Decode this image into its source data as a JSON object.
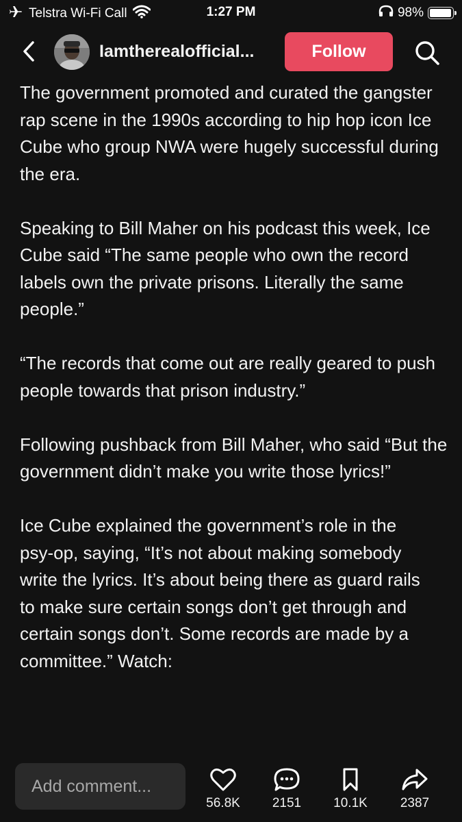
{
  "status_bar": {
    "carrier": "Telstra Wi-Fi Call",
    "time": "1:27 PM",
    "battery": "98%",
    "battery_level": 0.98,
    "icons": [
      "airplane-icon",
      "wifi-icon",
      "headphones-icon",
      "battery-icon"
    ]
  },
  "header": {
    "username": "Iamtherealofficial...",
    "follow_label": "Follow",
    "follow_color": "#e84a5f",
    "icons": [
      "back-chevron-icon",
      "search-icon"
    ]
  },
  "post": {
    "paragraphs": [
      "The government promoted and curated the gangster rap scene in the 1990s according to hip hop icon Ice Cube who group NWA were hugely successful during the era.",
      "Speaking to Bill Maher on his podcast this week, Ice Cube said “The same people who own the record labels own the private prisons. Literally the same people.”",
      "“The records that come out are really geared to push people towards that prison industry.”",
      "Following pushback from Bill Maher, who said “But the government didn’t make you write those lyrics!”",
      "Ice Cube explained the government’s role in the psy-op, saying, “It’s not about making somebody write the lyrics. It’s about being there as guard rails to make sure certain songs don’t get through and certain songs don’t. Some records are made by a committee.” Watch:"
    ]
  },
  "bottom_bar": {
    "comment_placeholder": "Add comment...",
    "likes": "56.8K",
    "comments": "2151",
    "saves": "10.1K",
    "shares": "2387",
    "icons": [
      "heart-icon",
      "comment-icon",
      "bookmark-icon",
      "share-icon"
    ]
  }
}
